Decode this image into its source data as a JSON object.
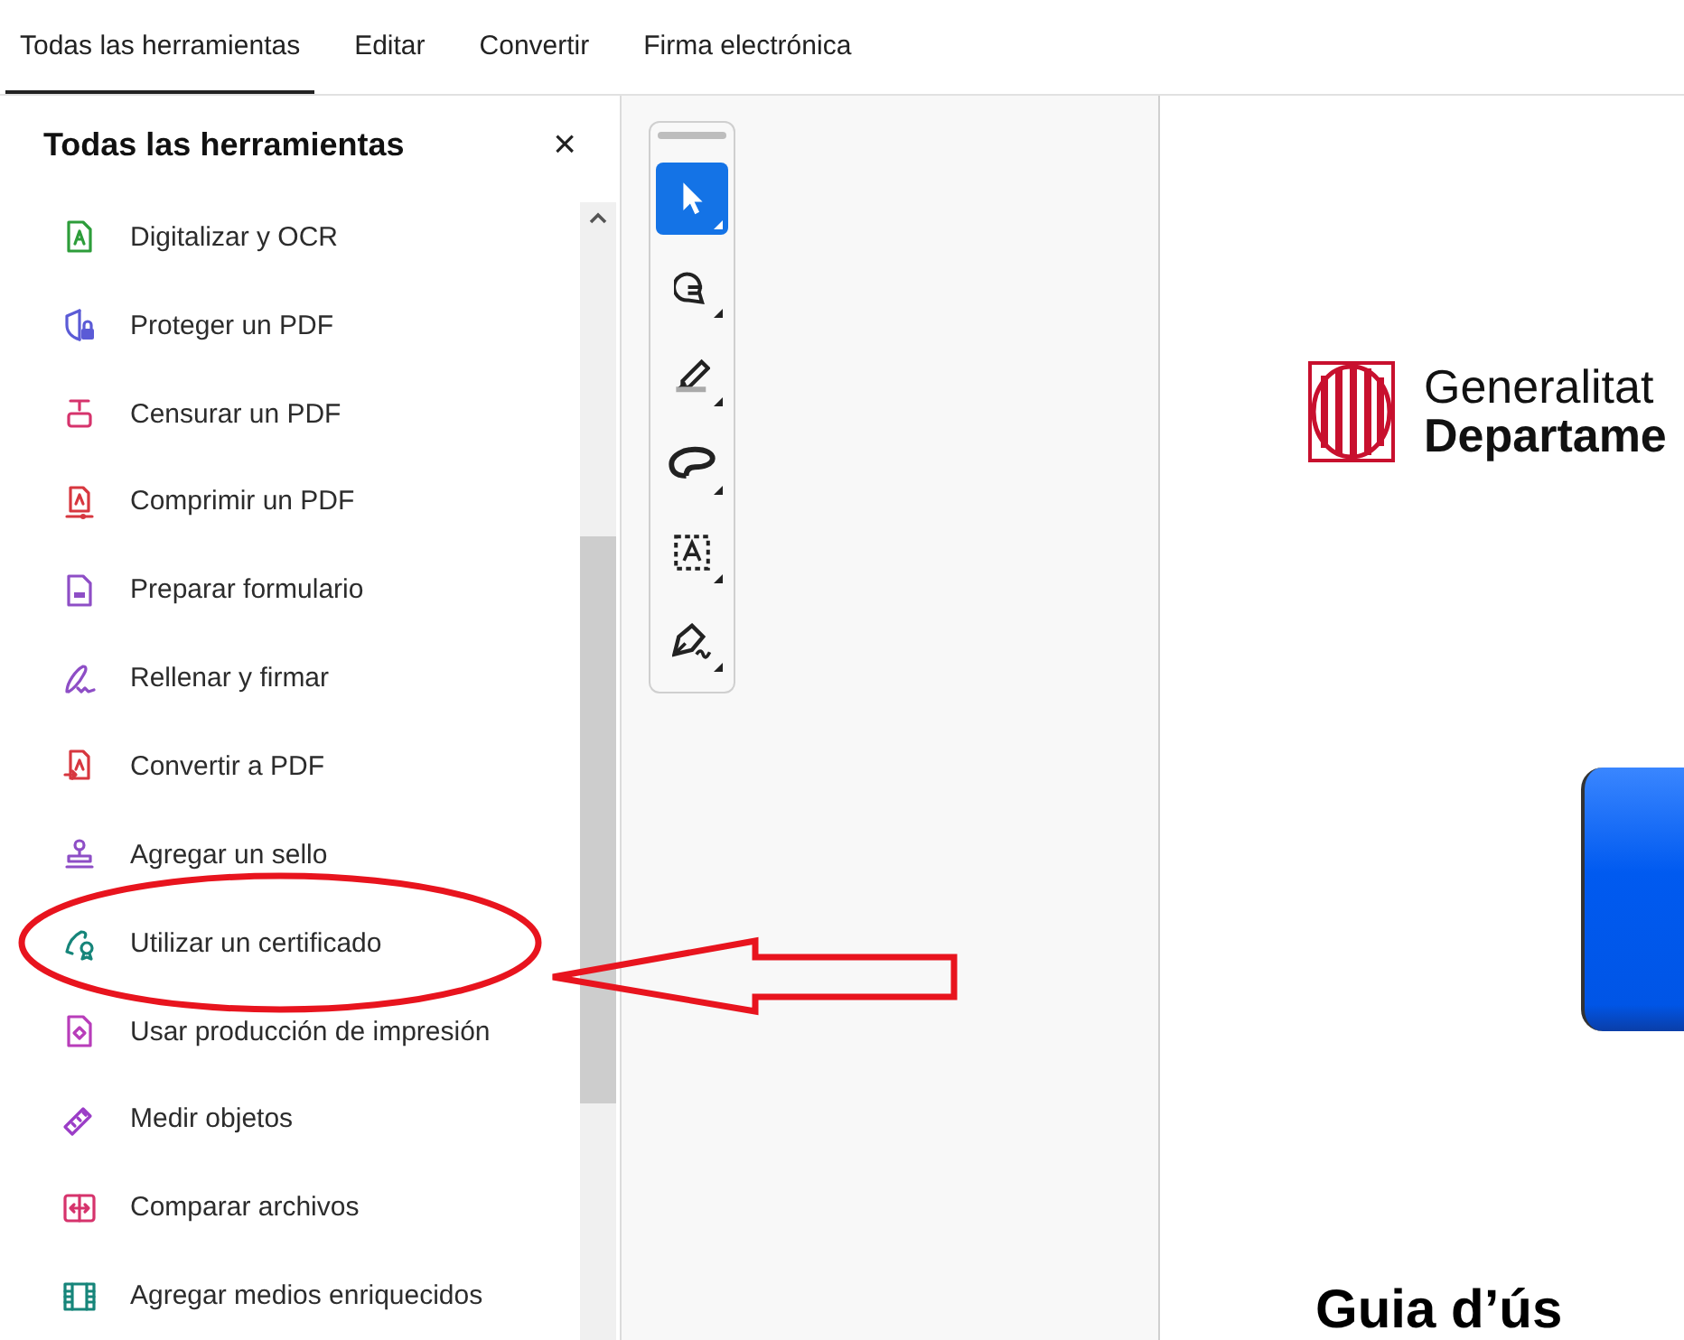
{
  "tabs": [
    {
      "label": "Todas las herramientas",
      "selected": true
    },
    {
      "label": "Editar",
      "selected": false
    },
    {
      "label": "Convertir",
      "selected": false
    },
    {
      "label": "Firma electrónica",
      "selected": false
    }
  ],
  "panel": {
    "title": "Todas las herramientas",
    "close": "×",
    "items": [
      {
        "label": "Digitalizar y OCR",
        "color": "#2d9d3a"
      },
      {
        "label": "Proteger un PDF",
        "color": "#5b5bd6"
      },
      {
        "label": "Censurar un PDF",
        "color": "#d6336c"
      },
      {
        "label": "Comprimir un PDF",
        "color": "#d7373f"
      },
      {
        "label": "Preparar formulario",
        "color": "#8e4ec6"
      },
      {
        "label": "Rellenar y firmar",
        "color": "#8e4ec6"
      },
      {
        "label": "Convertir a PDF",
        "color": "#d7373f"
      },
      {
        "label": "Agregar un sello",
        "color": "#8e4ec6"
      },
      {
        "label": "Utilizar un certificado",
        "color": "#16857a"
      },
      {
        "label": "Usar producción de impresión",
        "color": "#b83dba"
      },
      {
        "label": "Medir objetos",
        "color": "#9b3dc7"
      },
      {
        "label": "Comparar archivos",
        "color": "#d6336c"
      },
      {
        "label": "Agregar medios enriquecidos",
        "color": "#16857a"
      }
    ]
  },
  "toolbar": {
    "tools": [
      {
        "selected": true
      },
      {
        "selected": false
      },
      {
        "selected": false
      },
      {
        "selected": false
      },
      {
        "selected": false
      },
      {
        "selected": false
      }
    ]
  },
  "document": {
    "logo_lines": [
      "Generalitat",
      "Departame"
    ],
    "title": "Guia d’ús"
  }
}
